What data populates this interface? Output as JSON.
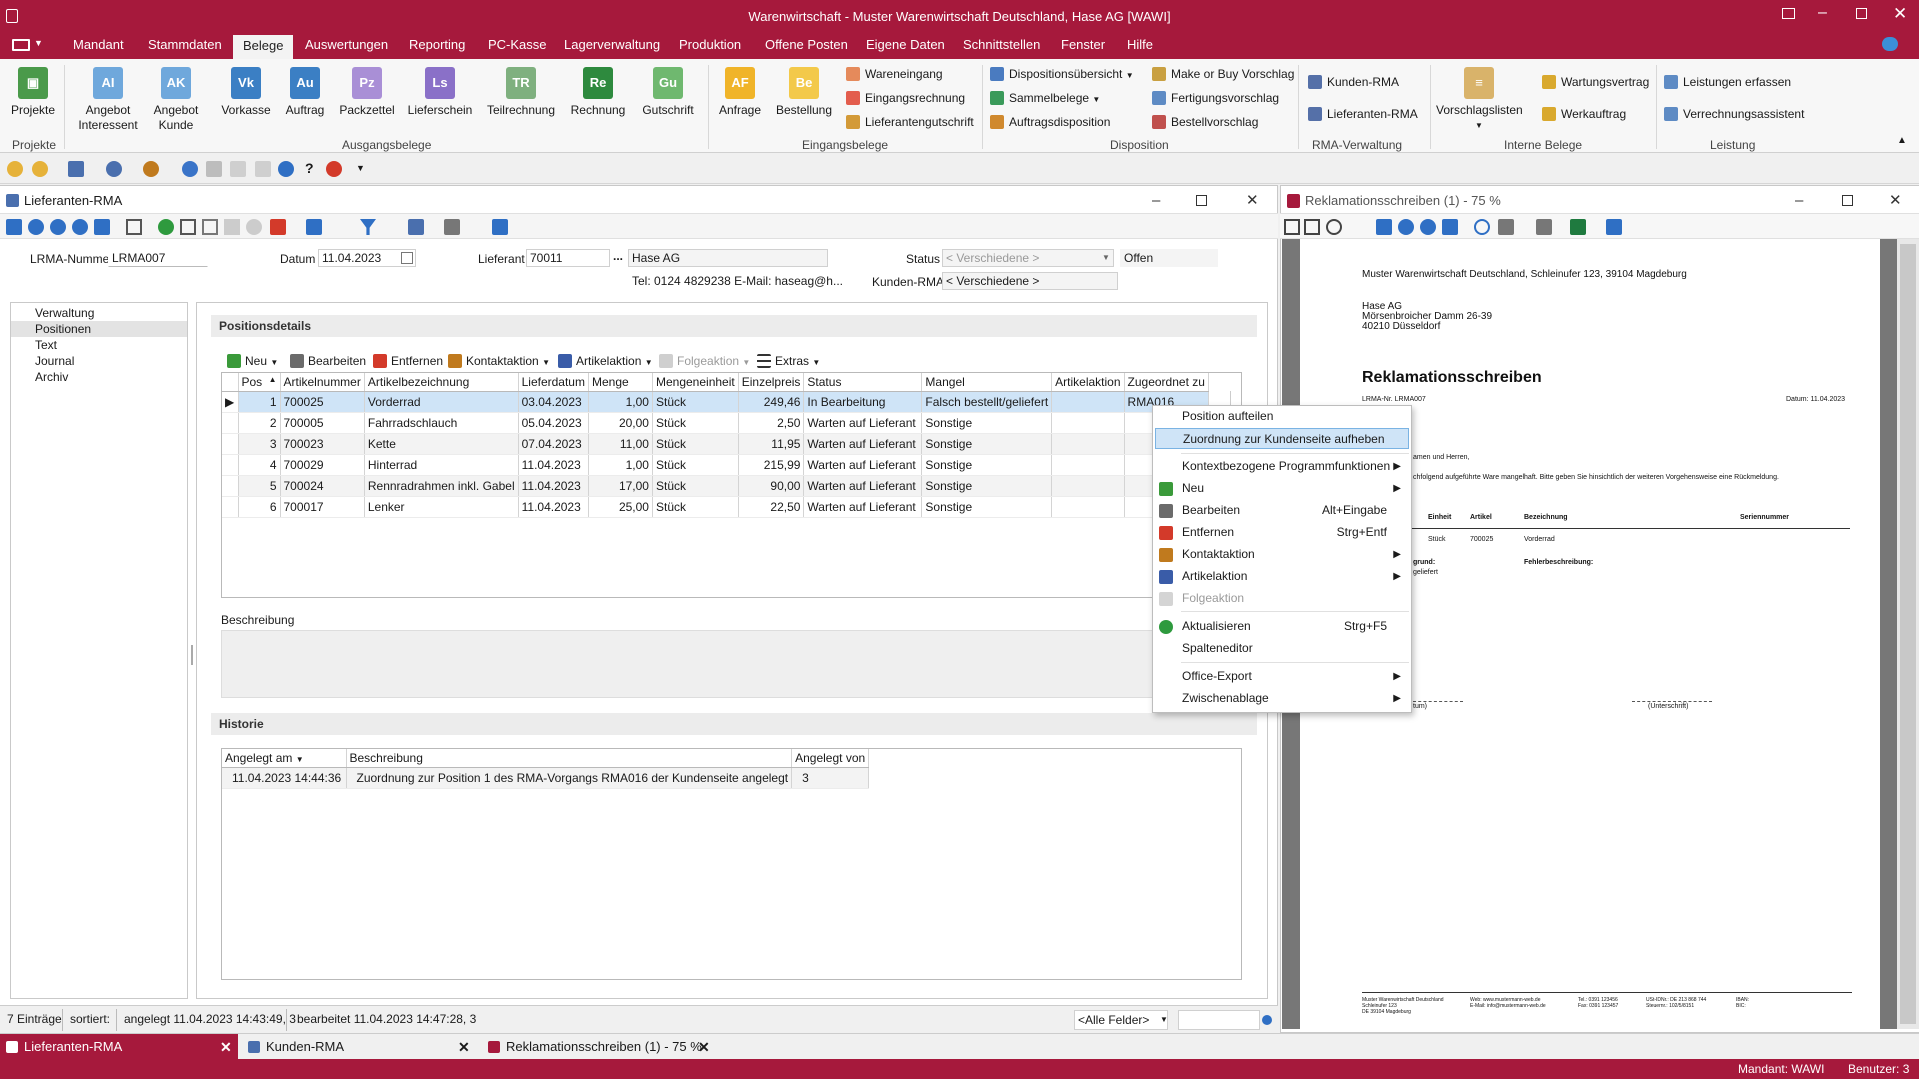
{
  "app": {
    "title": "Warenwirtschaft - Muster Warenwirtschaft Deutschland, Hase AG [WAWI]",
    "accent": "#a6193c"
  },
  "menu": [
    "Mandant",
    "Stammdaten",
    "Belege",
    "Auswertungen",
    "Reporting",
    "PC-Kasse",
    "Lagerverwaltung",
    "Produktion",
    "Offene Posten",
    "Eigene Daten",
    "Schnittstellen",
    "Fenster",
    "Hilfe"
  ],
  "menu_active": "Belege",
  "ribbon": {
    "projekte": "Projekte",
    "angebot_interessent": [
      "Angebot",
      "Interessent"
    ],
    "angebot_kunde": [
      "Angebot",
      "Kunde"
    ],
    "vorkasse": "Vorkasse",
    "auftrag": "Auftrag",
    "packzettel": "Packzettel",
    "lieferschein": "Lieferschein",
    "teilrechnung": "Teilrechnung",
    "rechnung": "Rechnung",
    "gutschrift": "Gutschrift",
    "anfrage": "Anfrage",
    "bestellung": "Bestellung",
    "wareneingang": "Wareneingang",
    "eingangsrechnung": "Eingangsrechnung",
    "lieferantengutschrift": "Lieferantengutschrift",
    "dispositionsuebersicht": "Dispositionsübersicht",
    "sammelbelege": "Sammelbelege",
    "auftragsdisposition": "Auftragsdisposition",
    "make_or_buy": "Make or Buy Vorschlag",
    "fertigungsvorschlag": "Fertigungsvorschlag",
    "bestellvorschlag": "Bestellvorschlag",
    "kunden_rma": "Kunden-RMA",
    "lieferanten_rma": "Lieferanten-RMA",
    "vorschlagslisten": "Vorschlagslisten",
    "wartungsvertrag": "Wartungsvertrag",
    "werkauftrag": "Werkauftrag",
    "leistungen_erfassen": "Leistungen erfassen",
    "verrechnungsassistent": "Verrechnungsassistent",
    "groups": {
      "projekte": "Projekte",
      "ausgangsbelege": "Ausgangsbelege",
      "eingangsbelege": "Eingangsbelege",
      "disposition": "Disposition",
      "rma": "RMA-Verwaltung",
      "interne": "Interne Belege",
      "leistung": "Leistung"
    }
  },
  "rma_window": {
    "title": "Lieferanten-RMA",
    "lrma_label": "LRMA-Nummer",
    "lrma_value": "LRMA007",
    "datum_label": "Datum",
    "datum_value": "11.04.2023",
    "lieferant_label": "Lieferant",
    "lieferant_value": "70011",
    "lieferant_ellipsis": "...",
    "lieferant_name": "Hase AG",
    "contact": "Tel: 0124 4829238   E-Mail: haseag@h...",
    "status_label": "Status",
    "status_value": "< Verschiedene >",
    "status_text": "Offen",
    "kunden_rma_label": "Kunden-RMA",
    "kunden_rma_value": "< Verschiedene >",
    "nav": [
      "Verwaltung",
      "Positionen",
      "Text",
      "Journal",
      "Archiv"
    ],
    "positionsdetails": "Positionsdetails",
    "toolbar": {
      "neu": "Neu",
      "bearbeiten": "Bearbeiten",
      "entfernen": "Entfernen",
      "kontaktaktion": "Kontaktaktion",
      "artikelaktion": "Artikelaktion",
      "folgeaktion": "Folgeaktion",
      "extras": "Extras"
    },
    "columns": [
      "Pos",
      "Artikelnummer",
      "Artikelbezeichnung",
      "Lieferdatum",
      "Menge",
      "Mengeneinheit",
      "Einzelpreis",
      "Status",
      "Mangel",
      "Artikelaktion",
      "Zugeordnet zu"
    ],
    "rows": [
      [
        "1",
        "700025",
        "Vorderrad",
        "03.04.2023",
        "1,00",
        "Stück",
        "249,46",
        "In Bearbeitung",
        "Falsch bestellt/geliefert",
        "",
        "RMA016"
      ],
      [
        "2",
        "700005",
        "Fahrradschlauch",
        "05.04.2023",
        "20,00",
        "Stück",
        "2,50",
        "Warten auf Lieferant",
        "Sonstige",
        "",
        ""
      ],
      [
        "3",
        "700023",
        "Kette",
        "07.04.2023",
        "11,00",
        "Stück",
        "11,95",
        "Warten auf Lieferant",
        "Sonstige",
        "",
        ""
      ],
      [
        "4",
        "700029",
        "Hinterrad",
        "11.04.2023",
        "1,00",
        "Stück",
        "215,99",
        "Warten auf Lieferant",
        "Sonstige",
        "",
        ""
      ],
      [
        "5",
        "700024",
        "Rennradrahmen inkl. Gabel",
        "11.04.2023",
        "17,00",
        "Stück",
        "90,00",
        "Warten auf Lieferant",
        "Sonstige",
        "",
        ""
      ],
      [
        "6",
        "700017",
        "Lenker",
        "11.04.2023",
        "25,00",
        "Stück",
        "22,50",
        "Warten auf Lieferant",
        "Sonstige",
        "",
        ""
      ]
    ],
    "beschreibung": "Beschreibung",
    "historie": "Historie",
    "hist_columns": [
      "Angelegt am",
      "Beschreibung",
      "Angelegt von"
    ],
    "hist_rows": [
      [
        "11.04.2023 14:44:36",
        "Zuordnung zur Position 1 des RMA-Vorgangs RMA016 der Kundenseite angelegt",
        "3"
      ]
    ],
    "status_bar": {
      "entries": "7 Einträge",
      "sorted": "sortiert:",
      "created": "angelegt 11.04.2023 14:43:49,  3",
      "edited": "bearbeitet 11.04.2023 14:47:28,  3",
      "filter": "<Alle Felder>"
    }
  },
  "context_menu": [
    {
      "label": "Position aufteilen",
      "shortcut": "",
      "submenu": false,
      "disabled": false,
      "highlight": false,
      "icon": ""
    },
    {
      "label": "Zuordnung zur Kundenseite aufheben",
      "shortcut": "",
      "submenu": false,
      "disabled": false,
      "highlight": true,
      "icon": ""
    },
    {
      "label": "Kontextbezogene Programmfunktionen",
      "shortcut": "",
      "submenu": true,
      "disabled": false,
      "highlight": false,
      "icon": ""
    },
    {
      "label": "Neu",
      "shortcut": "",
      "submenu": true,
      "disabled": false,
      "highlight": false,
      "icon": "#3a9a3a"
    },
    {
      "label": "Bearbeiten",
      "shortcut": "Alt+Eingabe",
      "submenu": false,
      "disabled": false,
      "highlight": false,
      "icon": "#6b6b6b"
    },
    {
      "label": "Entfernen",
      "shortcut": "Strg+Entf",
      "submenu": false,
      "disabled": false,
      "highlight": false,
      "icon": "#d33a2a"
    },
    {
      "label": "Kontaktaktion",
      "shortcut": "",
      "submenu": true,
      "disabled": false,
      "highlight": false,
      "icon": "#c07a1e"
    },
    {
      "label": "Artikelaktion",
      "shortcut": "",
      "submenu": true,
      "disabled": false,
      "highlight": false,
      "icon": "#3a5ca8"
    },
    {
      "label": "Folgeaktion",
      "shortcut": "",
      "submenu": false,
      "disabled": true,
      "highlight": false,
      "icon": "#bdbdbd"
    },
    {
      "label": "Aktualisieren",
      "shortcut": "Strg+F5",
      "submenu": false,
      "disabled": false,
      "highlight": false,
      "icon": "#2e9a3e"
    },
    {
      "label": "Spalteneditor",
      "shortcut": "",
      "submenu": false,
      "disabled": false,
      "highlight": false,
      "icon": ""
    },
    {
      "label": "Office-Export",
      "shortcut": "",
      "submenu": true,
      "disabled": false,
      "highlight": false,
      "icon": ""
    },
    {
      "label": "Zwischenablage",
      "shortcut": "",
      "submenu": true,
      "disabled": false,
      "highlight": false,
      "icon": ""
    }
  ],
  "preview": {
    "title": "Reklamationsschreiben (1) - 75 %",
    "sender": "Muster Warenwirtschaft Deutschland, Schleinufer 123, 39104 Magdeburg",
    "addr1": "Hase AG",
    "addr2": "Mörsenbroicher Damm 26-39",
    "addr3": "40210 Düsseldorf",
    "heading": "Reklamationsschreiben",
    "lrma": "LRMA-Nr. LRMA007",
    "date": "Datum: 11.04.2023",
    "greeting": "amen und Herren,",
    "body": "chfolgend aufgeführte Ware mangelhaft. Bitte geben Sie hinsichtlich der weiteren Vorgehensweise eine Rückmeldung.",
    "th_einheit": "Einheit",
    "th_artikel": "Artikel",
    "th_bez": "Bezeichnung",
    "th_serie": "Seriennummer",
    "row_einheit": "Stück",
    "row_artikel": "700025",
    "row_bez": "Vorderrad",
    "grund": "grund:",
    "grund_val": "geliefert",
    "fehler": "Fehlerbeschreibung:",
    "sig1": "tum)",
    "sig2": "(Unterschrift)",
    "foot1": "Muster Warenwirtschaft Deutschland",
    "foot1b": "Schleinufer 123",
    "foot1c": "DE 39104 Magdeburg",
    "foot2": "Web: www.mustermann-web.de",
    "foot2b": "E-Mail: info@mustermann-web.de",
    "foot3": "Tel.: 0391 123456",
    "foot3b": "Fax: 0391 123457",
    "foot4": "USt-IDNr.: DE 213 868 744",
    "foot4b": "Steuernr.: 102/5/8151",
    "foot5": "IBAN:",
    "foot5b": "BIC:"
  },
  "bottom_tabs": [
    "Lieferanten-RMA",
    "Kunden-RMA",
    "Reklamationsschreiben (1) - 75 %"
  ],
  "bottom_status": {
    "mandant": "Mandant: WAWI",
    "benutzer": "Benutzer: 3"
  }
}
